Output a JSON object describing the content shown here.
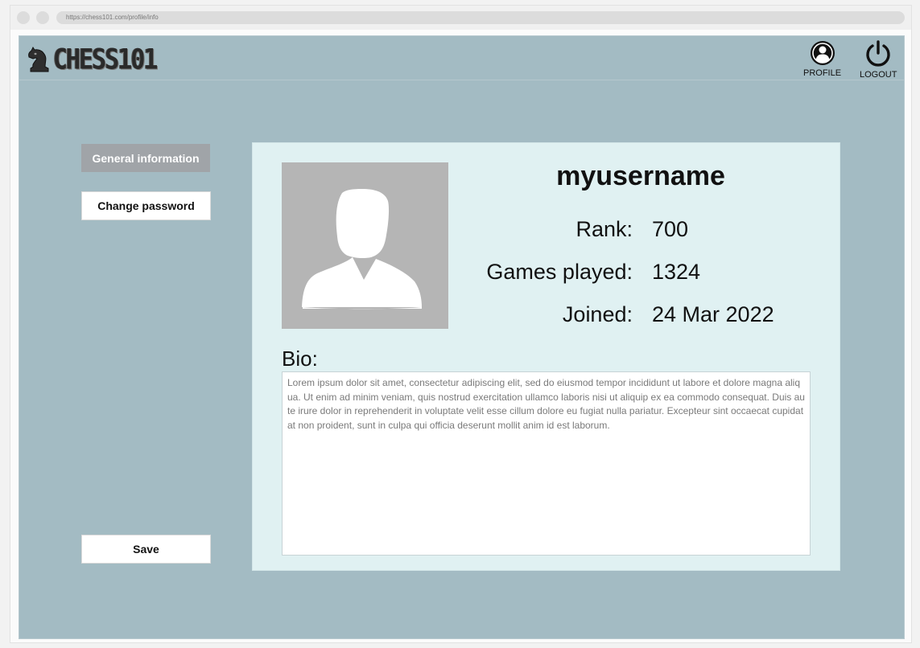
{
  "browser": {
    "url": "https://chess101.com/profile/info"
  },
  "header": {
    "logo_text": "CHESS101",
    "profile_label": "PROFILE",
    "logout_label": "LOGOUT"
  },
  "sidebar": {
    "items": [
      {
        "label": "General information",
        "active": true
      },
      {
        "label": "Change password",
        "active": false
      }
    ],
    "save_label": "Save"
  },
  "profile": {
    "username": "myusername",
    "stats": [
      {
        "label": "Rank:",
        "value": "700"
      },
      {
        "label": "Games played:",
        "value": "1324"
      },
      {
        "label": "Joined:",
        "value": "24 Mar 2022"
      }
    ],
    "bio_label": "Bio:",
    "bio_text": "Lorem ipsum dolor sit amet, consectetur adipiscing elit, sed do eiusmod tempor incididunt ut labore et dolore magna aliqua. Ut enim ad minim veniam, quis nostrud exercitation ullamco laboris nisi ut aliquip ex ea commodo consequat. Duis aute irure dolor in reprehenderit in voluptate velit esse cillum dolore eu fugiat nulla pariatur. Excepteur sint occaecat cupidatat non proident, sunt in culpa qui officia deserunt mollit anim id est laborum."
  },
  "colors": {
    "page_background": "#a3bbc3",
    "card_background": "#e0f1f2",
    "active_tab": "#a0a4a8",
    "avatar_placeholder": "#b5b5b5"
  },
  "icons": {
    "logo": "chess-knight-icon",
    "profile": "user-circle-icon",
    "logout": "power-icon",
    "avatar": "user-silhouette-icon"
  }
}
